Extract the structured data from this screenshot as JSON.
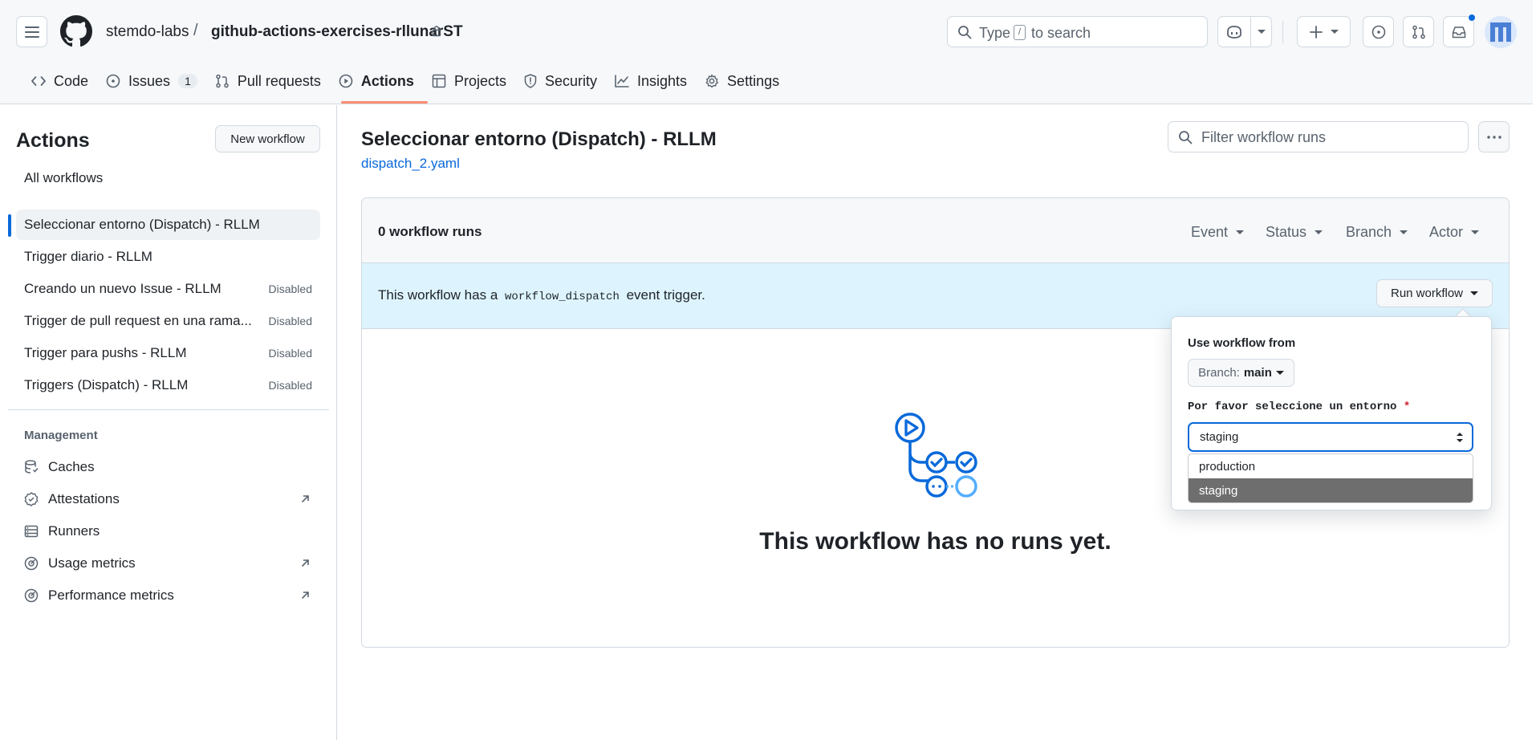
{
  "header": {
    "owner": "stemdo-labs",
    "separator": "/",
    "repo": "github-actions-exercises-rllunarST",
    "search_prefix": "Type",
    "search_key": "/",
    "search_suffix": "to search"
  },
  "repo_nav": [
    {
      "label": "Code",
      "icon": "code-icon"
    },
    {
      "label": "Issues",
      "icon": "issue-icon",
      "count": "1"
    },
    {
      "label": "Pull requests",
      "icon": "pull-request-icon"
    },
    {
      "label": "Actions",
      "icon": "play-icon",
      "active": true
    },
    {
      "label": "Projects",
      "icon": "table-icon"
    },
    {
      "label": "Security",
      "icon": "shield-icon"
    },
    {
      "label": "Insights",
      "icon": "graph-icon"
    },
    {
      "label": "Settings",
      "icon": "gear-icon"
    }
  ],
  "sidebar": {
    "title": "Actions",
    "new_workflow": "New workflow",
    "all_workflows": "All workflows",
    "workflows": [
      {
        "label": "Seleccionar entorno (Dispatch) - RLLM",
        "status": "",
        "active": true
      },
      {
        "label": "Trigger diario - RLLM",
        "status": ""
      },
      {
        "label": "Creando un nuevo Issue - RLLM",
        "status": "Disabled"
      },
      {
        "label": "Trigger de pull request en una rama...",
        "status": "Disabled"
      },
      {
        "label": "Trigger para pushs - RLLM",
        "status": "Disabled"
      },
      {
        "label": "Triggers (Dispatch) - RLLM",
        "status": "Disabled"
      }
    ],
    "management_title": "Management",
    "management": [
      {
        "label": "Caches",
        "icon": "database-icon"
      },
      {
        "label": "Attestations",
        "icon": "verified-icon",
        "external": true
      },
      {
        "label": "Runners",
        "icon": "server-icon"
      },
      {
        "label": "Usage metrics",
        "icon": "meter-icon",
        "external": true
      },
      {
        "label": "Performance metrics",
        "icon": "meter-icon",
        "external": true
      }
    ]
  },
  "main": {
    "title": "Seleccionar entorno (Dispatch) - RLLM",
    "file": "dispatch_2.yaml",
    "filter_placeholder": "Filter workflow runs",
    "runs_count": "0 workflow runs",
    "filters": [
      "Event",
      "Status",
      "Branch",
      "Actor"
    ],
    "banner_pre": "This workflow has a",
    "banner_code": "workflow_dispatch",
    "banner_post": "event trigger.",
    "run_workflow": "Run workflow",
    "empty_message": "This workflow has no runs yet."
  },
  "popover": {
    "use_from": "Use workflow from",
    "branch_prefix": "Branch:",
    "branch_value": "main",
    "input_label": "Por favor seleccione un entorno",
    "required_mark": "*",
    "selected": "staging",
    "options": [
      "production",
      "staging"
    ]
  },
  "colors": {
    "accent": "#0969da",
    "nav_underline": "#fd8c73",
    "banner_bg": "#ddf4ff",
    "selected_option_bg": "#6e6e6e"
  }
}
